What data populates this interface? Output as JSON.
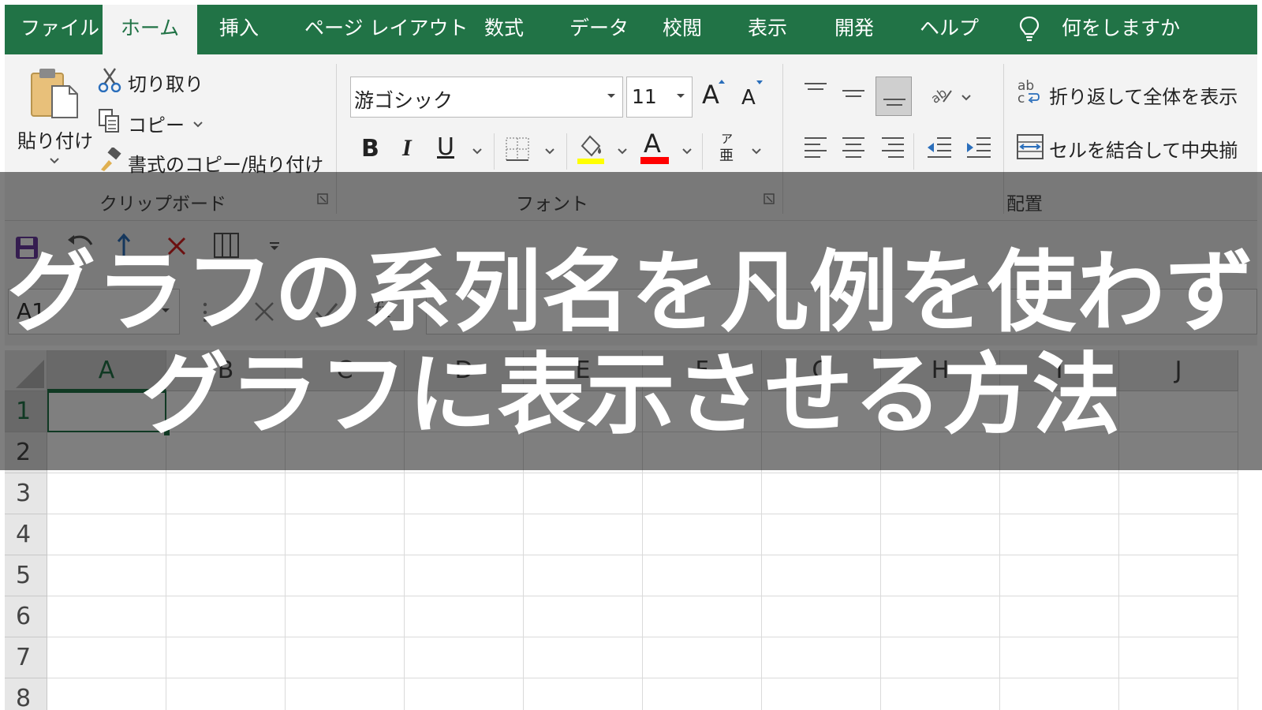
{
  "tabs": [
    "ファイル",
    "ホーム",
    "挿入",
    "ページ レイアウト",
    "数式",
    "データ",
    "校閲",
    "表示",
    "開発",
    "ヘルプ"
  ],
  "tell_me": "何をしますか",
  "clipboard": {
    "paste": "貼り付け",
    "cut": "切り取り",
    "copy": "コピー",
    "format_painter": "書式のコピー/貼り付け",
    "group_label": "クリップボード"
  },
  "font": {
    "name": "游ゴシック",
    "size": "11",
    "bold": "B",
    "italic": "I",
    "underline": "U",
    "grow": "A",
    "shrink": "A",
    "font_color": "A",
    "phonetic_top": "ア",
    "phonetic_bottom": "亜",
    "group_label": "フォント",
    "fill_color": "#ffff00",
    "text_color": "#ff0000"
  },
  "alignment": {
    "wrap_icon_top": "ab",
    "wrap_icon_bottom": "c",
    "wrap_text": "折り返して全体を表示",
    "merge": "セルを結合して中央揃",
    "group_label": "配置"
  },
  "formula_bar": {
    "name_box": "A1",
    "fx": "fx"
  },
  "grid": {
    "columns": [
      "A",
      "B",
      "C",
      "D",
      "E",
      "F",
      "G",
      "H",
      "I",
      "J"
    ],
    "rows": [
      "1",
      "2",
      "3",
      "4",
      "5",
      "6",
      "7",
      "8"
    ],
    "active_cell": "A1"
  },
  "title": {
    "line1": "グラフの系列名を凡例を使わず",
    "line2": "グラフに表示させる方法"
  },
  "colors": {
    "excel_green": "#217346",
    "overlay": "rgba(0,0,0,0.5)"
  }
}
